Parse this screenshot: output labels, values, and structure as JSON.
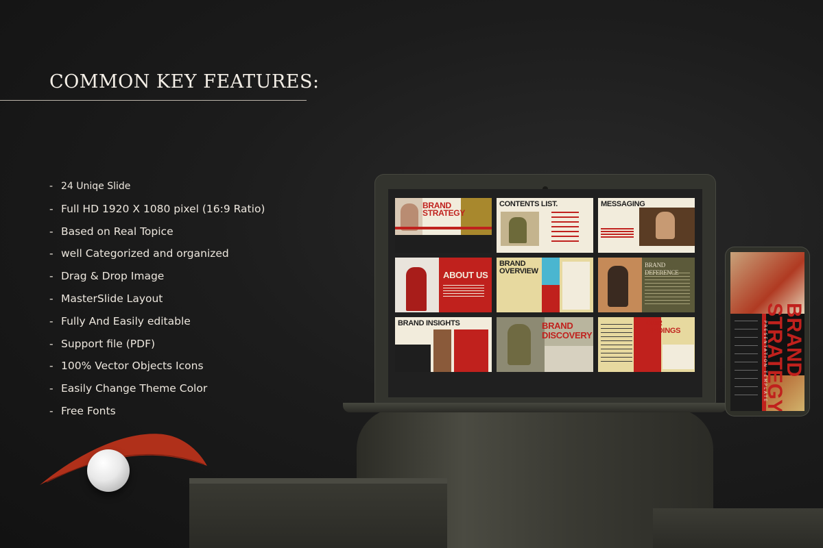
{
  "heading": "COMMON KEY FEATURES:",
  "features": [
    "24 Uniqe Slide",
    "Full HD 1920 X 1080 pixel (16:9 Ratio)",
    "Based on Real Topice",
    "well Categorized and organized",
    "Drag & Drop Image",
    "MasterSlide Layout",
    "Fully And Easily editable",
    "Support file (PDF)",
    "100% Vector Objects Icons",
    "Easily Change Theme Color",
    "Free Fonts"
  ],
  "dash": "-",
  "slides": {
    "s1": {
      "title": "BRAND STRATEGY"
    },
    "s2": {
      "title": "CONTENTS LIST."
    },
    "s3": {
      "title": "MESSAGING"
    },
    "s4": {
      "title": "ABOUT US"
    },
    "s5": {
      "title": "BRAND OVERVIEW"
    },
    "s6": {
      "title": "BRAND DEFERENCE"
    },
    "s7": {
      "title": "BRAND INSIGHTS"
    },
    "s8": {
      "title": "BRAND DISCOVERY"
    },
    "s9": {
      "title": "OUR FINDINGS"
    }
  },
  "phone": {
    "title": "BRAND STRATEGY",
    "subtitle": "PRESENTATION TEMPLATE"
  },
  "colors": {
    "accent_red": "#c0211d",
    "cream": "#f2ecdc",
    "background": "#1c1c1c"
  }
}
